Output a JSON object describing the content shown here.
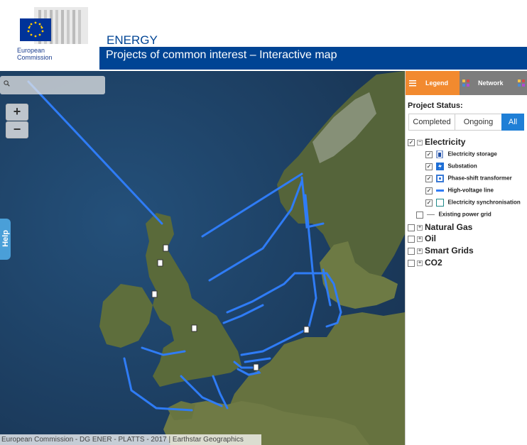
{
  "header": {
    "org": "European Commission",
    "site": "ENERGY",
    "title": "Projects of common interest – Interactive map"
  },
  "map": {
    "search_placeholder": "",
    "zoom_in": "+",
    "zoom_out": "−",
    "help": "Help",
    "attribution": "European Commission - DG ENER - PLATTS - 2017 | Earthstar Geographics"
  },
  "panel": {
    "tabs": [
      {
        "label": "Legend",
        "icon": "legend-icon",
        "active": true
      },
      {
        "label": "Network",
        "icon": "network-icon",
        "active": false
      }
    ],
    "status_label": "Project Status:",
    "status_options": [
      "Completed",
      "Ongoing",
      "All"
    ],
    "status_selected": "All",
    "categories": [
      {
        "label": "Electricity",
        "checked": true,
        "expanded": true,
        "items": [
          {
            "label": "Electricity storage",
            "checked": true,
            "icon": "storage-icon"
          },
          {
            "label": "Substation",
            "checked": true,
            "icon": "substation-icon"
          },
          {
            "label": "Phase-shift transformer",
            "checked": true,
            "icon": "phase-shift-icon"
          },
          {
            "label": "High-voltage line",
            "checked": true,
            "icon": "line-icon"
          },
          {
            "label": "Electricity synchronisation",
            "checked": true,
            "icon": "sync-icon"
          }
        ]
      },
      {
        "label": "Existing power grid",
        "checked": false
      },
      {
        "label": "Natural Gas",
        "checked": false,
        "expanded": false
      },
      {
        "label": "Oil",
        "checked": false,
        "expanded": false
      },
      {
        "label": "Smart Grids",
        "checked": false,
        "expanded": false
      },
      {
        "label": "CO2",
        "checked": false,
        "expanded": false
      }
    ]
  },
  "colors": {
    "brand": "#004494",
    "legend_tab": "#f28a2f",
    "all_button": "#1f7fd6",
    "lines": "#2f7cf6",
    "sea": "#1e3f63",
    "land": "#5f6d3c"
  }
}
